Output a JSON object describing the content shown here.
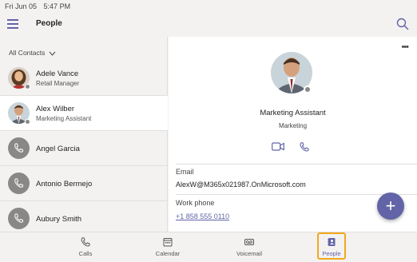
{
  "status": {
    "date": "Fri Jun 05",
    "time": "5:47 PM"
  },
  "header": {
    "title": "People"
  },
  "filter": {
    "label": "All Contacts"
  },
  "contacts": [
    {
      "name": "Adele Vance",
      "role": "Retail Manager"
    },
    {
      "name": "Alex Wilber",
      "role": "Marketing Assistant"
    },
    {
      "name": "Angel Garcia",
      "role": ""
    },
    {
      "name": "Antonio Bermejo",
      "role": ""
    },
    {
      "name": "Aubury Smith",
      "role": ""
    }
  ],
  "detail": {
    "job_title": "Marketing Assistant",
    "department": "Marketing",
    "email_label": "Email",
    "email_value": "AlexW@M365x021987.OnMicrosoft.com",
    "phone_label": "Work phone",
    "phone_value": "+1 858 555 0110"
  },
  "fab": {
    "label": "+"
  },
  "tabs": [
    {
      "label": "Calls",
      "icon": "phone-icon"
    },
    {
      "label": "Calendar",
      "icon": "calendar-icon"
    },
    {
      "label": "Voicemail",
      "icon": "voicemail-icon"
    },
    {
      "label": "People",
      "icon": "people-icon"
    }
  ],
  "colors": {
    "accent": "#6264a7",
    "highlight": "#f2a81d",
    "presence_offline": "#8a8886"
  }
}
